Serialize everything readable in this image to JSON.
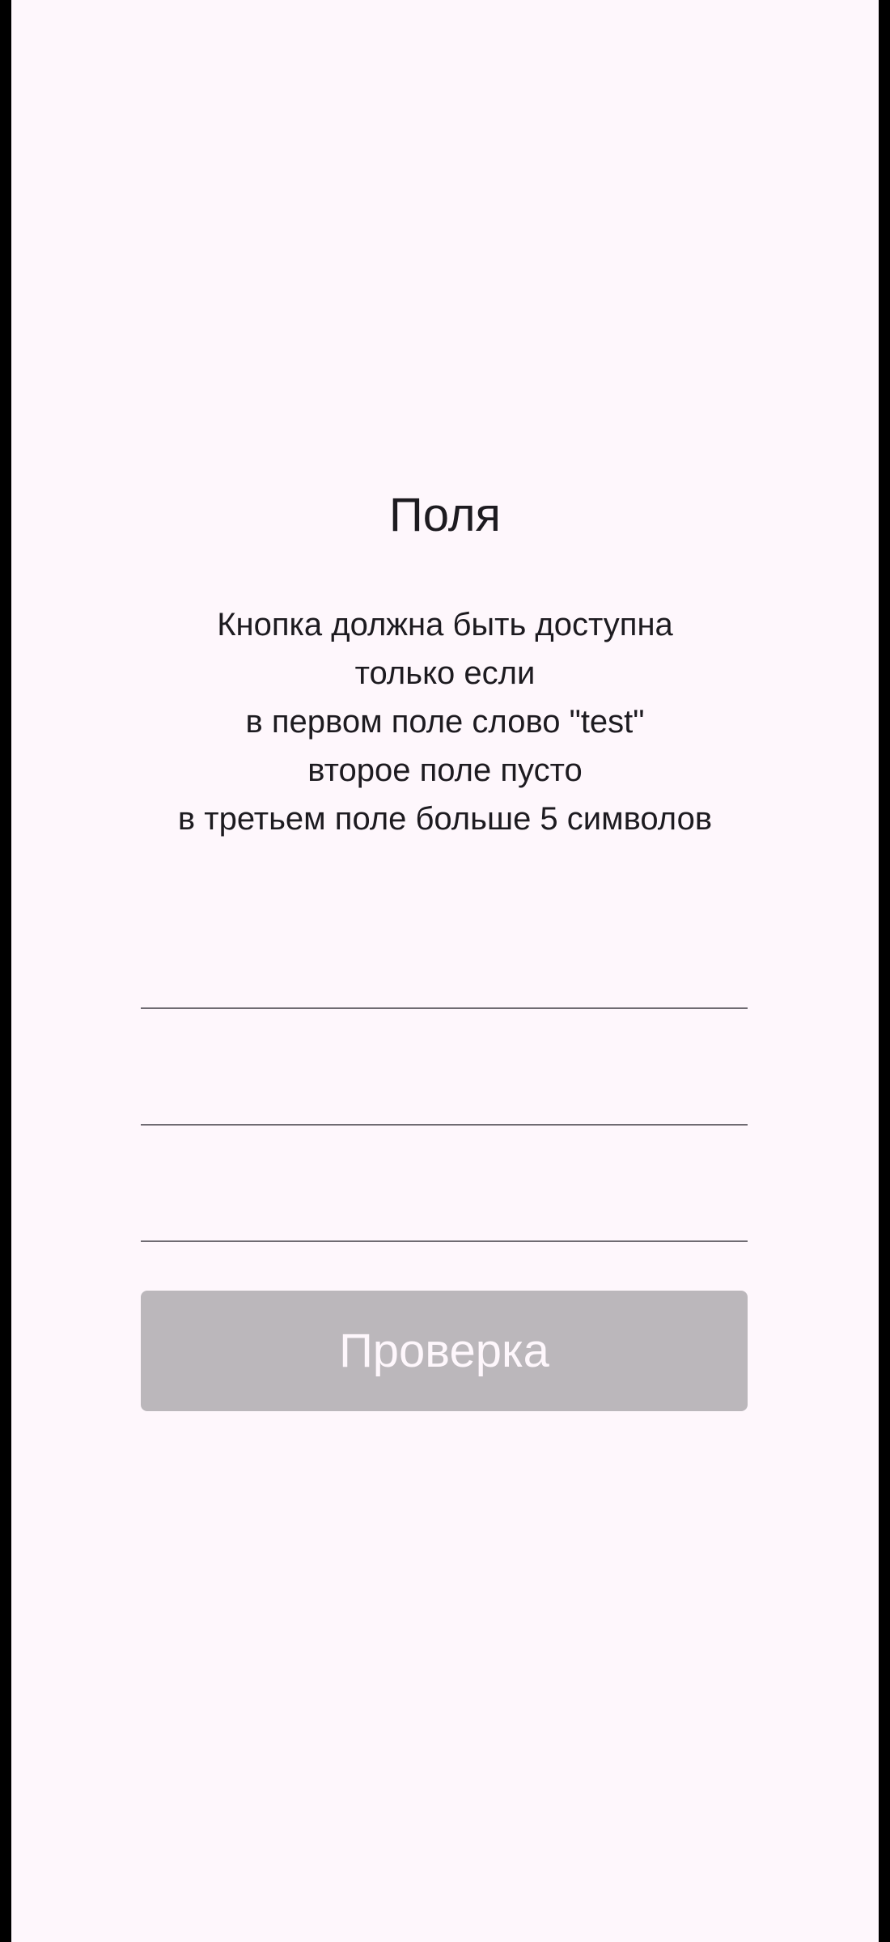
{
  "screen": {
    "title": "Поля",
    "description_lines": [
      "Кнопка должна быть доступна",
      "только если",
      "в первом поле слово \"test\"",
      "второе поле пусто",
      "в третьем поле больше 5 символов"
    ]
  },
  "fields": [
    {
      "value": "",
      "placeholder": ""
    },
    {
      "value": "",
      "placeholder": ""
    },
    {
      "value": "",
      "placeholder": ""
    }
  ],
  "button": {
    "label": "Проверка",
    "enabled": false
  },
  "colors": {
    "background": "#fef7fc",
    "text": "#1d1b20",
    "field_underline": "#6f6b72",
    "button_disabled_bg": "#bbb7bb",
    "button_disabled_text": "#fef7fc"
  }
}
